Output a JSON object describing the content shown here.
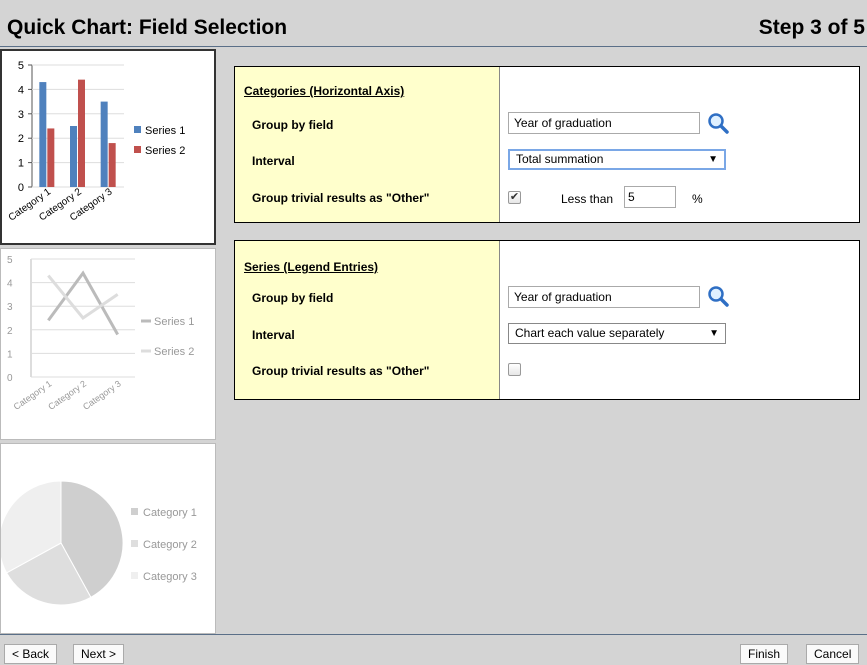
{
  "header": {
    "title": "Quick Chart: Field Selection",
    "step": "Step 3 of 5"
  },
  "thumbnails": {
    "bar": {
      "yticks": [
        "5",
        "4",
        "3",
        "2",
        "1",
        "0"
      ],
      "categories": [
        "Category 1",
        "Category 2",
        "Category 3"
      ],
      "legend": [
        "Series 1",
        "Series 2"
      ],
      "colors": {
        "series1": "#4f81bd",
        "series2": "#c0504d"
      }
    },
    "line": {
      "yticks": [
        "5",
        "4",
        "3",
        "2",
        "1",
        "0"
      ],
      "categories": [
        "Category 1",
        "Category 2",
        "Category 3"
      ],
      "legend": [
        "Series 1",
        "Series 2"
      ]
    },
    "pie": {
      "legend": [
        "Category 1",
        "Category 2",
        "Category 3"
      ]
    }
  },
  "chart_data": [
    {
      "type": "bar",
      "categories": [
        "Category 1",
        "Category 2",
        "Category 3"
      ],
      "series": [
        {
          "name": "Series 1",
          "values": [
            4.3,
            2.5,
            3.5
          ]
        },
        {
          "name": "Series 2",
          "values": [
            2.4,
            4.4,
            1.8
          ]
        }
      ],
      "ylim": [
        0,
        5
      ]
    },
    {
      "type": "line",
      "categories": [
        "Category 1",
        "Category 2",
        "Category 3"
      ],
      "series": [
        {
          "name": "Series 1",
          "values": [
            2.4,
            4.4,
            1.8
          ]
        },
        {
          "name": "Series 2",
          "values": [
            4.3,
            2.5,
            3.5
          ]
        }
      ],
      "ylim": [
        0,
        5
      ]
    },
    {
      "type": "pie",
      "categories": [
        "Category 1",
        "Category 2",
        "Category 3"
      ],
      "values": [
        42,
        25,
        33
      ]
    }
  ],
  "categories_section": {
    "title": "Categories (Horizontal Axis)",
    "group_by_label": "Group by field",
    "group_by_value": "Year of graduation",
    "interval_label": "Interval",
    "interval_value": "Total summation",
    "trivial_label": "Group trivial results as \"Other\"",
    "trivial_checked": "✔",
    "less_than_label": "Less than",
    "less_than_value": "5",
    "percent_label": "%"
  },
  "series_section": {
    "title": "Series (Legend Entries)",
    "group_by_label": "Group by field",
    "group_by_value": "Year of graduation",
    "interval_label": "Interval",
    "interval_value": "Chart each value separately",
    "trivial_label": "Group trivial results as \"Other\""
  },
  "footer": {
    "back": "< Back",
    "next": "Next >",
    "finish": "Finish",
    "cancel": "Cancel"
  },
  "icons": {
    "lookup": "magnifier-icon",
    "dropdown": "triangle-down",
    "checked": "checkmark"
  }
}
